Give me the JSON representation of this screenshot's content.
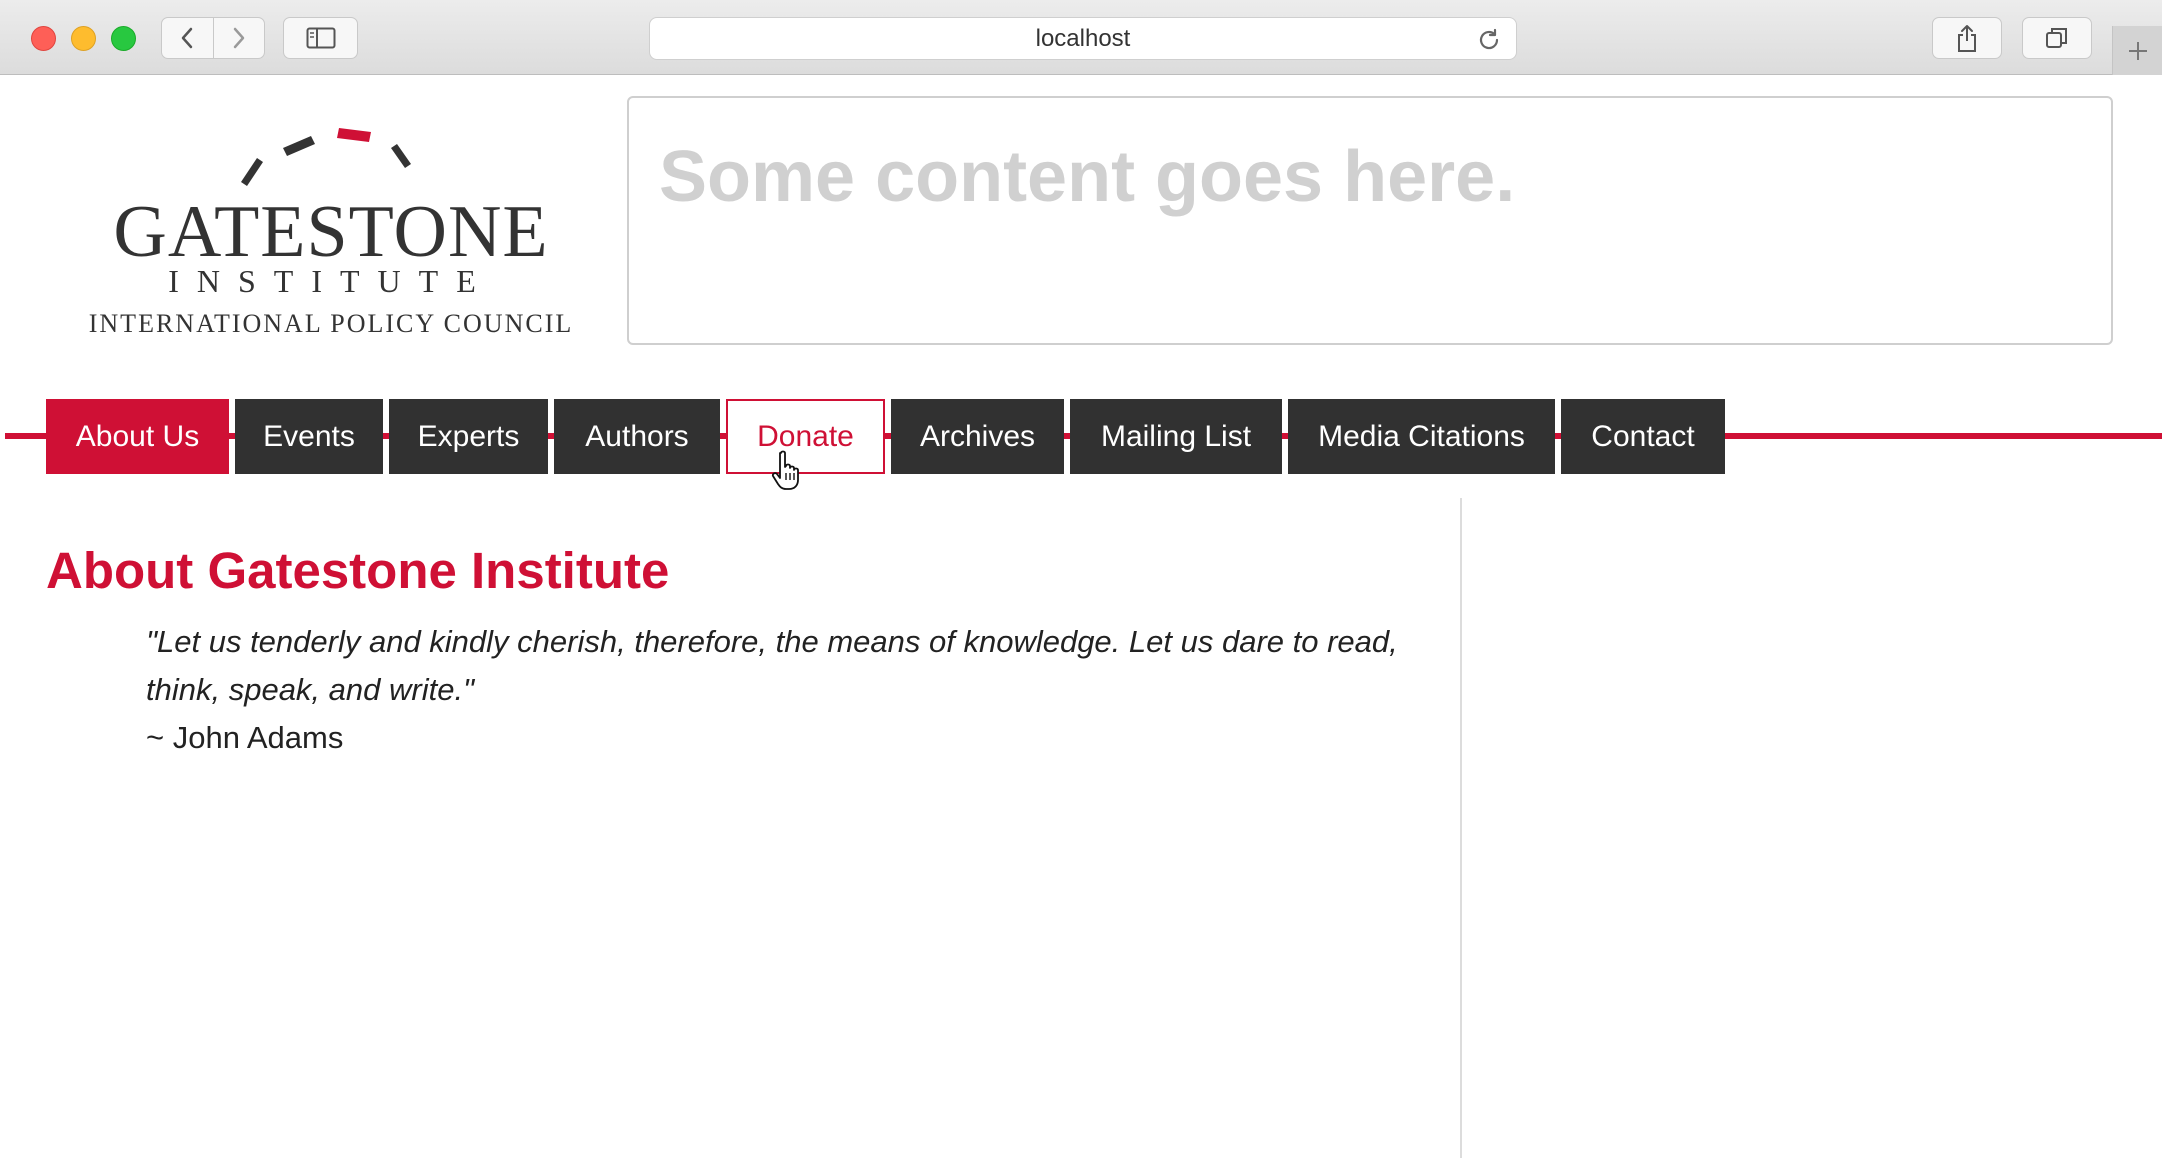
{
  "browser": {
    "url": "localhost",
    "icons": {
      "back": "chevron-left-icon",
      "forward": "chevron-right-icon",
      "sidebar": "sidebar-icon",
      "reload": "reload-icon",
      "share": "share-icon",
      "tabs": "tabs-icon",
      "newtab": "plus-icon"
    }
  },
  "logo": {
    "name": "GATESTONE",
    "sub": "INSTITUTE",
    "tagline": "INTERNATIONAL POLICY COUNCIL"
  },
  "content_box": {
    "text": "Some content goes here."
  },
  "nav": {
    "items": [
      {
        "label": "About Us",
        "state": "active"
      },
      {
        "label": "Events",
        "state": "normal"
      },
      {
        "label": "Experts",
        "state": "normal"
      },
      {
        "label": "Authors",
        "state": "normal"
      },
      {
        "label": "Donate",
        "state": "hover"
      },
      {
        "label": "Archives",
        "state": "normal"
      },
      {
        "label": "Mailing List",
        "state": "normal"
      },
      {
        "label": "Media Citations",
        "state": "normal"
      },
      {
        "label": "Contact",
        "state": "normal"
      }
    ]
  },
  "main": {
    "heading": "About Gatestone Institute",
    "quote": "\"Let us tenderly and kindly cherish, therefore, the means of knowledge. Let us dare to read, think, speak, and write.\"",
    "attribution": "~ John Adams"
  },
  "colors": {
    "accent": "#cf1035",
    "nav_bg": "#313131",
    "placeholder": "#d0d0d0"
  }
}
